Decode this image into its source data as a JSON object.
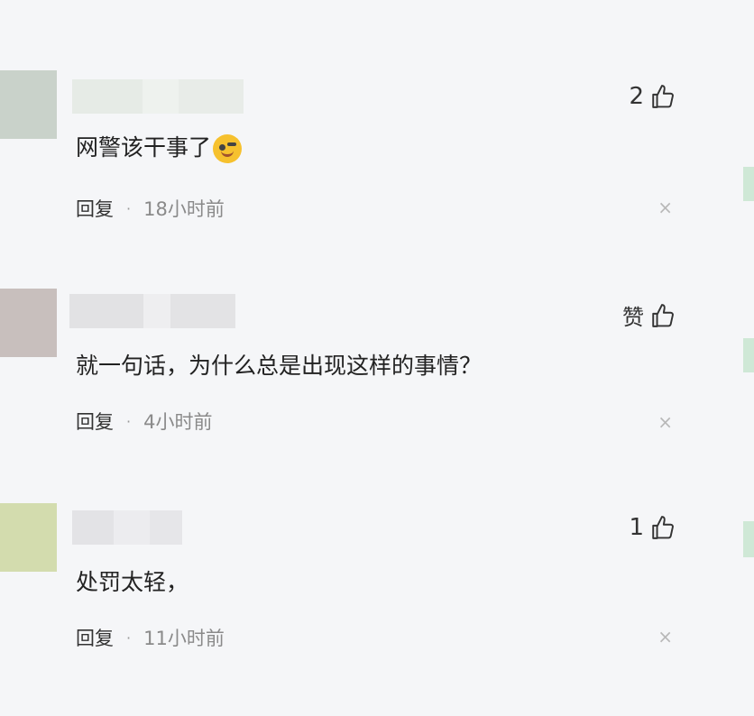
{
  "comments": [
    {
      "avatar_color": "#c9d2ca",
      "name_blur_colors": [
        "#e6ebe6",
        "#eef2ee",
        "#e8ece8"
      ],
      "text": "网警该干事了",
      "emoji": "smirk-face-emoji",
      "like_label": "2",
      "reply_label": "回复",
      "separator": "·",
      "time": "18小时前",
      "close_symbol": "×"
    },
    {
      "avatar_color": "#c8bfbd",
      "name_blur_colors": [
        "#e2e2e4",
        "#eeeef0",
        "#e3e3e5"
      ],
      "text": "就一句话，为什么总是出现这样的事情？",
      "like_label": "赞",
      "reply_label": "回复",
      "separator": "·",
      "time": "4小时前",
      "close_symbol": "×"
    },
    {
      "avatar_color": "#d3dcae",
      "name_blur_colors": [
        "#e3e3e6",
        "#ececef",
        "#e6e6e9"
      ],
      "text": "处罚太轻，",
      "like_label": "1",
      "reply_label": "回复",
      "separator": "·",
      "time": "11小时前",
      "close_symbol": "×"
    }
  ],
  "icons": {
    "like": "thumbs-up-icon",
    "close": "close-icon"
  },
  "edge_accent_color": "#cfe8d6"
}
